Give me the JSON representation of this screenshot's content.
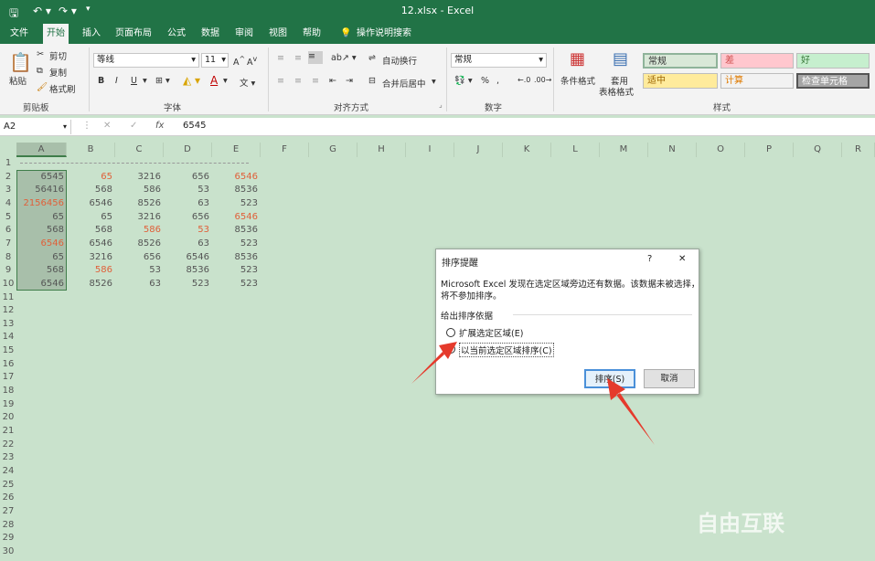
{
  "titlebar": {
    "title": "12.xlsx - Excel"
  },
  "menu": {
    "tabs": [
      "文件",
      "开始",
      "插入",
      "页面布局",
      "公式",
      "数据",
      "审阅",
      "视图",
      "帮助"
    ],
    "search": "操作说明搜索"
  },
  "ribbon": {
    "clipboard": {
      "paste": "粘贴",
      "cut": "剪切",
      "copy": "复制",
      "format_painter": "格式刷",
      "label": "剪贴板"
    },
    "font": {
      "name": "等线",
      "size": "11",
      "label": "字体",
      "bold": "B",
      "italic": "I",
      "underline": "U"
    },
    "alignment": {
      "wrap": "自动换行",
      "merge": "合并后居中",
      "label": "对齐方式"
    },
    "number": {
      "format": "常规",
      "label": "数字"
    },
    "styles": {
      "conditional": "条件格式",
      "table_format_1": "套用",
      "table_format_2": "表格格式",
      "label": "样式",
      "cells": [
        "常规",
        "差",
        "好",
        "适中",
        "计算",
        "检查单元格"
      ],
      "colors": {
        "normal": "#d9e8d8",
        "bad": "#ffc7ce",
        "good": "#c6efce",
        "neutral": "#ffeb9c",
        "calc": "#f2f2f2",
        "check": "#a5a5a5"
      }
    }
  },
  "formula": {
    "namebox": "A2",
    "fx": "fx",
    "value": "6545"
  },
  "columns": [
    "A",
    "B",
    "C",
    "D",
    "E",
    "F",
    "G",
    "H",
    "I",
    "J",
    "K",
    "L",
    "M",
    "N",
    "O",
    "P",
    "Q",
    "R"
  ],
  "rows": [
    "1",
    "2",
    "3",
    "4",
    "5",
    "6",
    "7",
    "8",
    "9",
    "10",
    "11",
    "12",
    "13",
    "14",
    "15",
    "16",
    "17",
    "18",
    "19",
    "20",
    "21",
    "22",
    "23",
    "24",
    "25",
    "26",
    "27",
    "28",
    "29",
    "30"
  ],
  "table": [
    [
      "6545",
      "65",
      "3216",
      "656",
      "6546"
    ],
    [
      "56416",
      "568",
      "586",
      "53",
      "8536"
    ],
    [
      "2156456",
      "6546",
      "8526",
      "63",
      "523"
    ],
    [
      "65",
      "65",
      "3216",
      "656",
      "6546"
    ],
    [
      "568",
      "568",
      "586",
      "53",
      "8536"
    ],
    [
      "6546",
      "6546",
      "8526",
      "63",
      "523"
    ],
    [
      "65",
      "3216",
      "656",
      "6546",
      "8536"
    ],
    [
      "568",
      "586",
      "53",
      "8536",
      "523"
    ],
    [
      "6546",
      "8526",
      "63",
      "523",
      "523"
    ]
  ],
  "red_cells": [
    [
      0,
      1
    ],
    [
      0,
      4
    ],
    [
      2,
      0
    ],
    [
      3,
      4
    ],
    [
      4,
      2
    ],
    [
      4,
      3
    ],
    [
      5,
      0
    ],
    [
      7,
      1
    ]
  ],
  "dialog": {
    "title": "排序提醒",
    "help": "?",
    "close": "✕",
    "message_1": "Microsoft Excel 发现在选定区域旁边还有数据。该数据未被选择，",
    "message_2": "将不参加排序。",
    "group": "给出排序依据",
    "opt_expand": "扩展选定区域(E)",
    "opt_current": "以当前选定区域排序(C)",
    "sort": "排序(S)",
    "cancel": "取消"
  },
  "watermark": "自由互联"
}
